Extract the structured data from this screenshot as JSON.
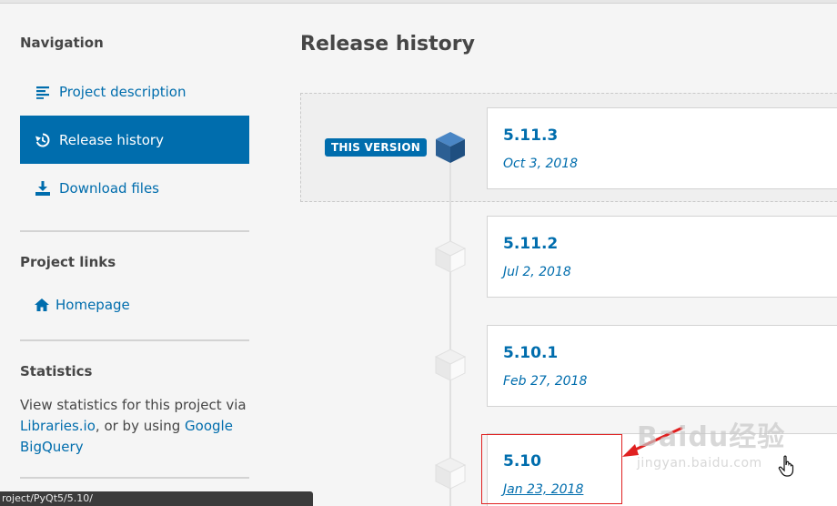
{
  "sidebar": {
    "navigation_heading": "Navigation",
    "nav_items": [
      {
        "label": "Project description",
        "icon": "align-left-icon"
      },
      {
        "label": "Release history",
        "icon": "history-icon"
      },
      {
        "label": "Download files",
        "icon": "download-icon"
      }
    ],
    "project_links_heading": "Project links",
    "homepage_label": "Homepage",
    "statistics_heading": "Statistics",
    "statistics_text_1": "View statistics for this project via",
    "statistics_link_1": "Libraries.io",
    "statistics_text_2": ", or by using",
    "statistics_link_2": "Google BigQuery"
  },
  "main": {
    "title": "Release history",
    "this_version_badge": "THIS VERSION",
    "releases": [
      {
        "version": "5.11.3",
        "date": "Oct 3, 2018"
      },
      {
        "version": "5.11.2",
        "date": "Jul 2, 2018"
      },
      {
        "version": "5.10.1",
        "date": "Feb 27, 2018"
      },
      {
        "version": "5.10",
        "date": "Jan 23, 2018"
      }
    ]
  },
  "watermark": {
    "main": "Baidu经验",
    "sub": "jingyan.baidu.com"
  },
  "status_bar": {
    "url": "roject/PyQt5/5.10/"
  },
  "colors": {
    "accent": "#006dad",
    "highlight": "#e02020"
  }
}
